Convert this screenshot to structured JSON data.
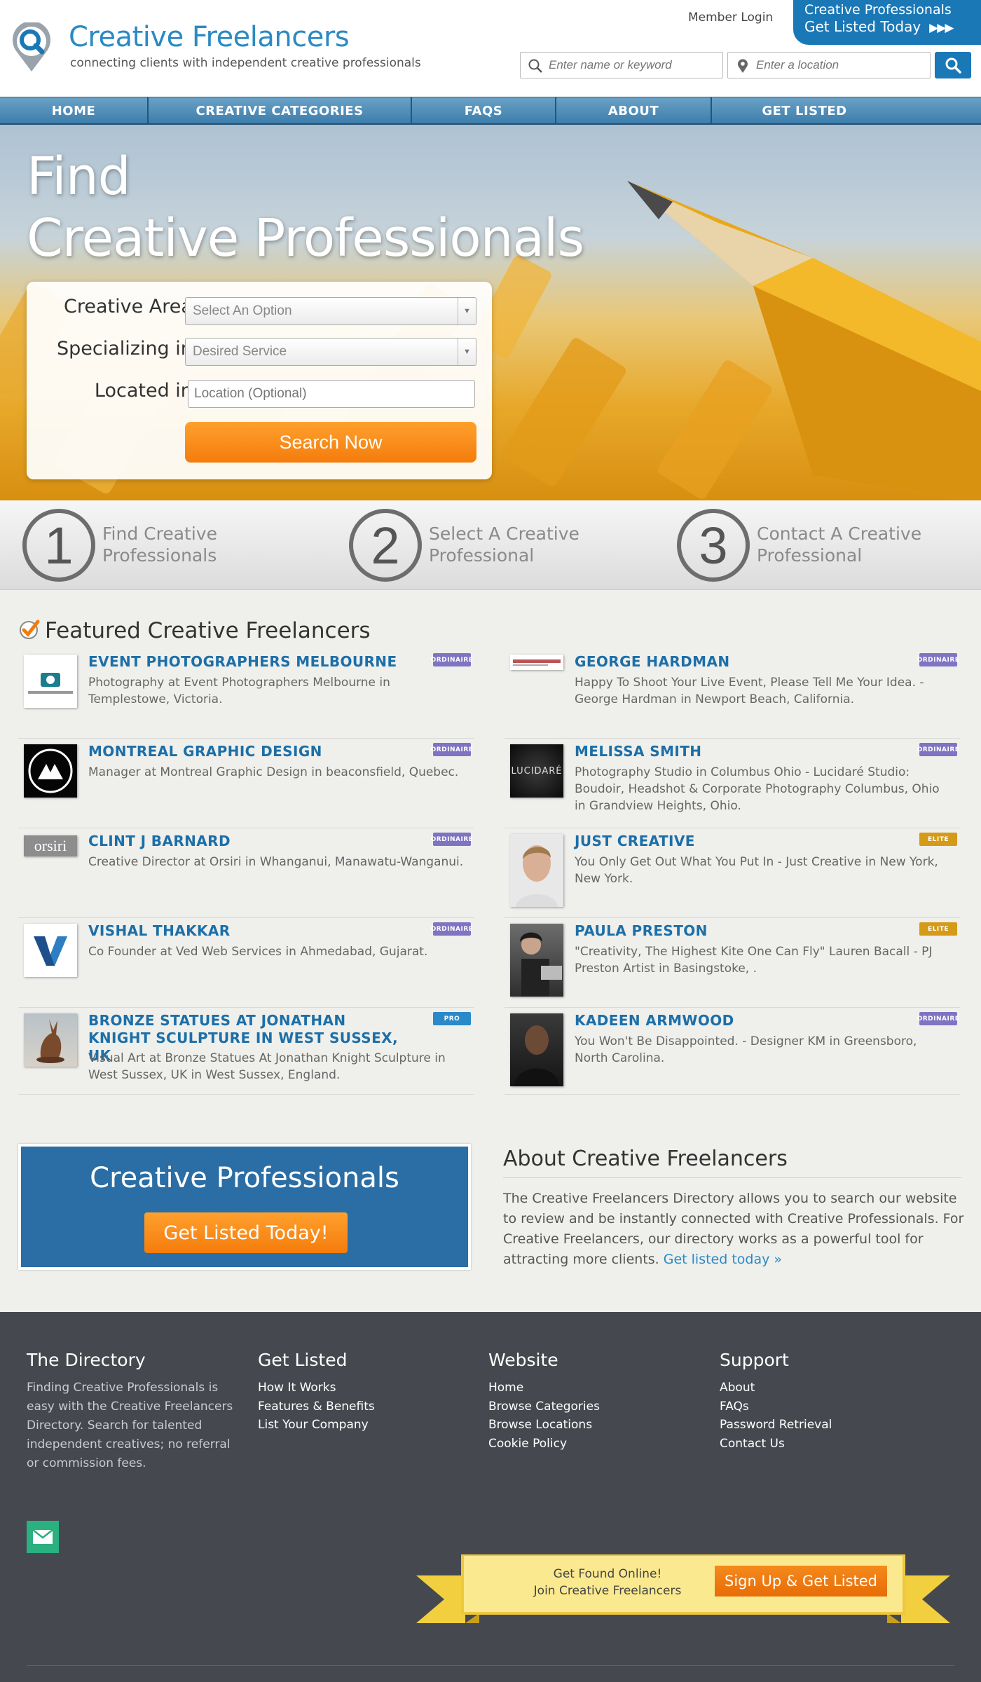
{
  "header": {
    "logo_title": "Creative Freelancers",
    "logo_tagline": "connecting clients with independent creative professionals",
    "member_login": "Member Login",
    "cta_line1": "Creative Professionals",
    "cta_line2": "Get Listed Today",
    "cta_arrows": "▶▶▶",
    "keyword_placeholder": "Enter name or keyword",
    "location_placeholder": "Enter a location",
    "brand_color": "#1a78b7"
  },
  "nav": {
    "items": [
      {
        "label": "HOME"
      },
      {
        "label": "CREATIVE CATEGORIES"
      },
      {
        "label": "FAQS"
      },
      {
        "label": "ABOUT"
      },
      {
        "label": "GET LISTED"
      }
    ]
  },
  "hero": {
    "title_line1": "Find",
    "title_line2": "Creative Professionals",
    "form": {
      "area_label": "Creative Area:",
      "area_value": "Select An Option",
      "specializing_label": "Specializing in:",
      "specializing_value": "Desired Service",
      "location_label": "Located in:",
      "location_placeholder": "Location (Optional)",
      "search_button": "Search Now"
    }
  },
  "steps": [
    {
      "number": "1",
      "line1": "Find Creative",
      "line2": "Professionals"
    },
    {
      "number": "2",
      "line1": "Select A Creative",
      "line2": "Professional"
    },
    {
      "number": "3",
      "line1": "Contact A Creative",
      "line2": "Professional"
    }
  ],
  "featured": {
    "title": "Featured Creative Freelancers",
    "badge_colors": {
      "ordinaire": "#7e74c2",
      "elite": "#d59a18",
      "pro": "#2a8ac9"
    },
    "left": [
      {
        "name": "EVENT PHOTOGRAPHERS MELBOURNE",
        "desc": "Photography at Event Photographers Melbourne in Templestowe, Victoria.",
        "badge": "ORDINAIRE"
      },
      {
        "name": "MONTREAL GRAPHIC DESIGN",
        "desc": "Manager at Montreal Graphic Design in beaconsfield, Quebec.",
        "badge": "ORDINAIRE"
      },
      {
        "name": "CLINT J BARNARD",
        "desc": "Creative Director at Orsiri in Whanganui, Manawatu-Wanganui.",
        "badge": "ORDINAIRE",
        "logo_text": "orsiri"
      },
      {
        "name": "VISHAL THAKKAR",
        "desc": "Co Founder at Ved Web Services in Ahmedabad, Gujarat.",
        "badge": "ORDINAIRE"
      },
      {
        "name": "BRONZE STATUES AT JONATHAN KNIGHT SCULPTURE IN WEST SUSSEX, UK",
        "desc": "Visual Art at Bronze Statues At Jonathan Knight Sculpture in West Sussex, UK in West Sussex, England.",
        "badge": "PRO"
      }
    ],
    "right": [
      {
        "name": "GEORGE HARDMAN",
        "desc": "Happy To Shoot Your Live Event, Please Tell Me Your Idea. - George Hardman in Newport Beach, California.",
        "badge": "ORDINAIRE"
      },
      {
        "name": "MELISSA SMITH",
        "desc": "Photography Studio in Columbus Ohio - Lucidaré Studio: Boudoir, Headshot & Corporate Photography Columbus, Ohio in Grandview Heights, Ohio.",
        "badge": "ORDINAIRE",
        "logo_text": "LUCIDARÉ"
      },
      {
        "name": "JUST CREATIVE",
        "desc": "You Only Get Out What You Put In - Just Creative in New York, New York.",
        "badge": "ELITE"
      },
      {
        "name": "PAULA PRESTON",
        "desc": "\"Creativity, The Highest Kite One Can Fly\" Lauren Bacall - PJ Preston Artist in Basingstoke, .",
        "badge": "ELITE"
      },
      {
        "name": "KADEEN ARMWOOD",
        "desc": "You Won't Be Disappointed. - Designer KM in Greensboro, North Carolina.",
        "badge": "ORDINAIRE"
      }
    ]
  },
  "promo": {
    "title": "Creative Professionals",
    "button": "Get Listed Today!"
  },
  "about": {
    "title": "About Creative Freelancers",
    "text": "The Creative Freelancers Directory allows you to search our website to review and be instantly connected with Creative Professionals. For Creative Freelancers, our directory works as a powerful tool for attracting more clients.",
    "link": "Get listed today »"
  },
  "footer": {
    "directory": {
      "heading": "The Directory",
      "text": "Finding Creative Professionals is easy with the Creative Freelancers Directory. Search for talented independent creatives; no referral or commission fees."
    },
    "get_listed": {
      "heading": "Get Listed",
      "links": [
        "How It Works",
        "Features & Benefits",
        "List Your Company"
      ]
    },
    "website": {
      "heading": "Website",
      "links": [
        "Home",
        "Browse Categories",
        "Browse Locations",
        "Cookie Policy"
      ]
    },
    "support": {
      "heading": "Support",
      "links": [
        "About",
        "FAQs",
        "Password Retrieval",
        "Contact Us"
      ]
    },
    "ribbon": {
      "line1": "Get Found Online!",
      "line2": "Join Creative Freelancers",
      "button": "Sign Up & Get Listed"
    }
  }
}
